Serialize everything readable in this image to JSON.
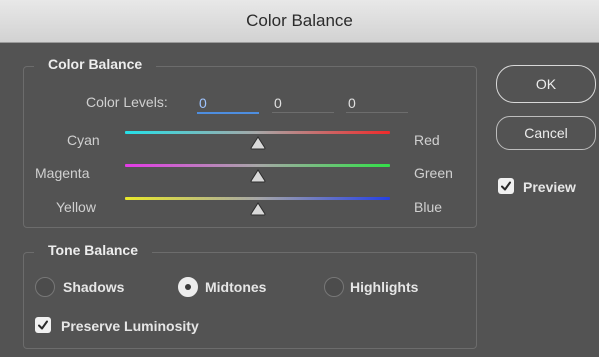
{
  "window": {
    "title": "Color Balance"
  },
  "color_balance": {
    "group_title": "Color Balance",
    "levels_label": "Color Levels:",
    "levels": [
      "0",
      "0",
      "0"
    ],
    "sliders": [
      {
        "left": "Cyan",
        "right": "Red",
        "value": 0,
        "min": -100,
        "max": 100
      },
      {
        "left": "Magenta",
        "right": "Green",
        "value": 0,
        "min": -100,
        "max": 100
      },
      {
        "left": "Yellow",
        "right": "Blue",
        "value": 0,
        "min": -100,
        "max": 100
      }
    ]
  },
  "tone_balance": {
    "group_title": "Tone Balance",
    "options": [
      "Shadows",
      "Midtones",
      "Highlights"
    ],
    "selected": "Midtones",
    "preserve_luminosity": {
      "label": "Preserve Luminosity",
      "checked": true
    }
  },
  "buttons": {
    "ok": "OK",
    "cancel": "Cancel"
  },
  "preview": {
    "label": "Preview",
    "checked": true
  },
  "colors": {
    "accent": "#4e8ee0",
    "background": "#535353"
  }
}
